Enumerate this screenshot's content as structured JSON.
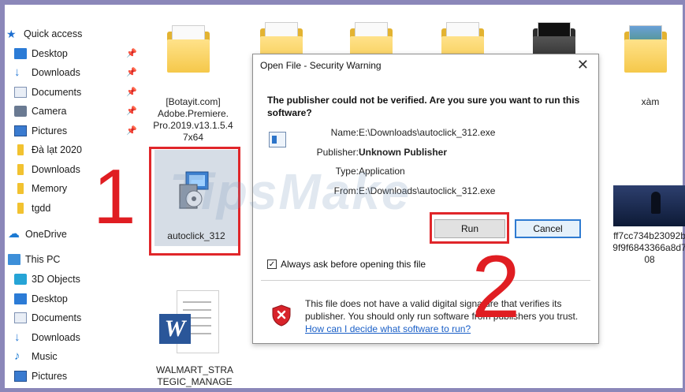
{
  "sidebar": {
    "quick_access": [
      {
        "label": "Quick access",
        "icon": "star-icon",
        "pinned": false
      },
      {
        "label": "Desktop",
        "icon": "desktop-icon",
        "pinned": true
      },
      {
        "label": "Downloads",
        "icon": "download-arrow-icon",
        "pinned": true
      },
      {
        "label": "Documents",
        "icon": "documents-icon",
        "pinned": true
      },
      {
        "label": "Camera",
        "icon": "camera-icon",
        "pinned": true
      },
      {
        "label": "Pictures",
        "icon": "pictures-icon",
        "pinned": true
      },
      {
        "label": "Đà lạt 2020",
        "icon": "folder-icon",
        "pinned": false
      },
      {
        "label": "Downloads",
        "icon": "folder-icon",
        "pinned": false
      },
      {
        "label": "Memory",
        "icon": "folder-icon",
        "pinned": false
      },
      {
        "label": "tgdd",
        "icon": "folder-icon",
        "pinned": false
      }
    ],
    "onedrive": {
      "label": "OneDrive",
      "icon": "cloud-icon"
    },
    "this_pc": [
      {
        "label": "This PC",
        "icon": "computer-icon"
      },
      {
        "label": "3D Objects",
        "icon": "3d-objects-icon"
      },
      {
        "label": "Desktop",
        "icon": "desktop-icon"
      },
      {
        "label": "Documents",
        "icon": "documents-icon"
      },
      {
        "label": "Downloads",
        "icon": "download-arrow-icon"
      },
      {
        "label": "Music",
        "icon": "music-icon"
      },
      {
        "label": "Pictures",
        "icon": "pictures-icon"
      }
    ]
  },
  "files": {
    "botayit": {
      "line1": "[Botayit.com]",
      "line2": "Adobe.Premiere.",
      "line3": "Pro.2019.v13.1.5.4",
      "line4": "7x64"
    },
    "autoclick": {
      "label": "autoclick_312"
    },
    "xam": {
      "label": "xàm"
    },
    "hashfile": {
      "line1": "ff7cc734b23092b",
      "line2": "9f9f6843366a8d7",
      "line3": "08"
    },
    "walmart": {
      "line1": "WALMART_STRA",
      "line2": "TEGIC_MANAGE"
    }
  },
  "annotations": {
    "step1": "1",
    "step2": "2",
    "watermark": "TipsMake"
  },
  "dialog": {
    "title": "Open File - Security Warning",
    "close_glyph": "✕",
    "question": "The publisher could not be verified.  Are you sure you want to run this software?",
    "fields": {
      "name": {
        "label": "Name:",
        "value": "E:\\Downloads\\autoclick_312.exe"
      },
      "publisher": {
        "label": "Publisher:",
        "value": "Unknown Publisher"
      },
      "type": {
        "label": "Type:",
        "value": "Application"
      },
      "from": {
        "label": "From:",
        "value": "E:\\Downloads\\autoclick_312.exe"
      }
    },
    "run_label": "Run",
    "cancel_label": "Cancel",
    "checkbox_label": "Always ask before opening this file",
    "checkbox_checked": true,
    "check_glyph": "✓",
    "warning_text": "This file does not have a valid digital signature that verifies its publisher.  You should only run software from publishers you trust.",
    "warning_link": "How can I decide what software to run?"
  },
  "colors": {
    "accent": "#2f7bd1",
    "annotation_red": "#e0262a",
    "frame": "#8b87b9"
  }
}
